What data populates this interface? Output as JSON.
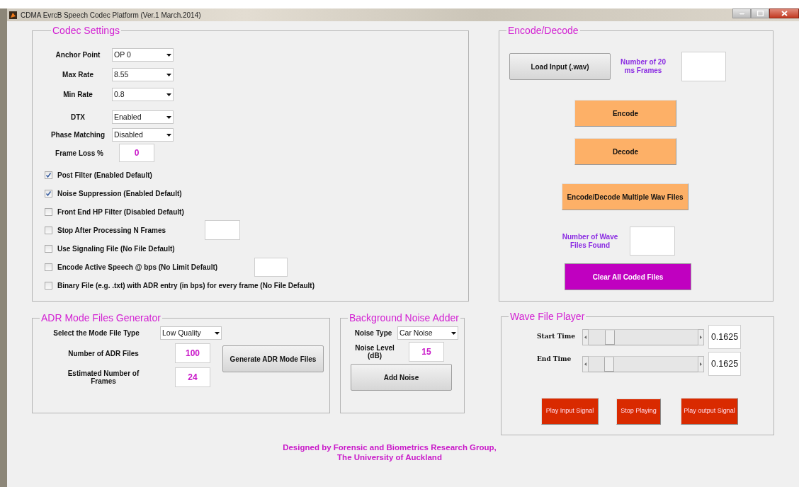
{
  "window": {
    "title": "CDMA EvrcB Speech Codec Platform (Ver.1 March.2014)"
  },
  "codec_settings": {
    "title": "Codec Settings",
    "dropdowns": [
      {
        "label": "Anchor Point",
        "value": "OP 0"
      },
      {
        "label": "Max Rate",
        "value": "8.55"
      },
      {
        "label": "Min Rate",
        "value": "0.8"
      },
      {
        "label": "DTX",
        "value": "Enabled"
      },
      {
        "label": "Phase Matching",
        "value": "Disabled"
      }
    ],
    "frame_loss": {
      "label": "Frame Loss %",
      "value": "0"
    },
    "options": [
      {
        "label": "Post Filter (Enabled Default)",
        "checked": true,
        "kind": "plain"
      },
      {
        "label": "Noise Suppression (Enabled Default)",
        "checked": true,
        "kind": "plain"
      },
      {
        "label": "Front End HP Filter (Disabled Default)",
        "checked": false,
        "kind": "plain"
      },
      {
        "label": "Stop After Processing N Frames",
        "checked": false,
        "kind": "field"
      },
      {
        "label": "Use Signaling File (No File Default)",
        "checked": false,
        "kind": "plain"
      },
      {
        "label": "Encode Active Speech @ bps (No Limit Default)",
        "checked": false,
        "kind": "field"
      },
      {
        "label": "Binary File (e.g. .txt) with ADR entry (in bps) for every frame (No File Default)",
        "checked": false,
        "kind": "plain"
      }
    ]
  },
  "encode_decode": {
    "title": "Encode/Decode",
    "load_button": "Load Input (.wav)",
    "frames_label": "Number of 20 ms Frames",
    "encode_button": "Encode",
    "decode_button": "Decode",
    "multi_button": "Encode/Decode Multiple Wav Files",
    "files_found_label": "Number of Wave Files Found",
    "clear_button": "Clear All Coded Files"
  },
  "adr_generator": {
    "title": "ADR Mode Files Generator",
    "mode_type": {
      "label": "Select the Mode File  Type",
      "value": "Low Quality"
    },
    "num_files": {
      "label": "Number of ADR Files",
      "value": "100"
    },
    "est_frames": {
      "label": "Estimated Number of Frames",
      "value": "24"
    },
    "generate_button": "Generate ADR Mode Files"
  },
  "noise_adder": {
    "title": "Background Noise Adder",
    "noise_type": {
      "label": "Noise Type",
      "value": "Car Noise"
    },
    "noise_level": {
      "label": "Noise Level (dB)",
      "value": "15"
    },
    "add_button": "Add Noise"
  },
  "wave_player": {
    "title": "Wave File Player",
    "sliders": [
      {
        "label": "Start Time",
        "level": 0.15,
        "reading": "0.1625"
      },
      {
        "label": "End Time",
        "level": 0.14,
        "reading": "0.1625"
      }
    ],
    "buttons": [
      "Play Input Signal",
      "Stop Playing",
      "Play output Signal"
    ]
  },
  "footer": [
    "Designed by Forensic and Biometrics Research Group,",
    "The University of Auckland"
  ]
}
